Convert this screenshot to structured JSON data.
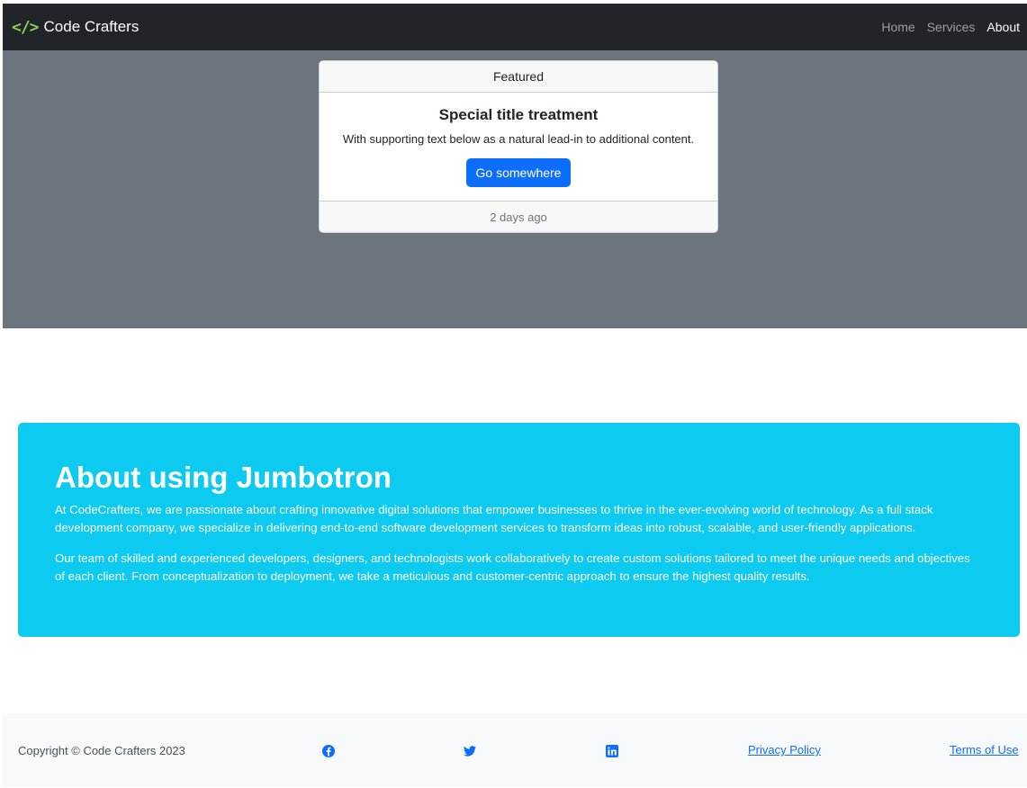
{
  "navbar": {
    "brand_icon": "</>",
    "brand": "Code Crafters",
    "links": [
      {
        "label": "Home",
        "active": false
      },
      {
        "label": "Services",
        "active": false
      },
      {
        "label": "About",
        "active": true
      }
    ]
  },
  "card": {
    "header": "Featured",
    "title": "Special title treatment",
    "text": "With supporting text below as a natural lead-in to additional content.",
    "button": "Go somewhere",
    "footer": "2 days ago"
  },
  "jumbotron": {
    "title": "About using Jumbotron",
    "paragraphs": [
      "At CodeCrafters, we are passionate about crafting innovative digital solutions that empower businesses to thrive in the ever-evolving world of technology. As a full stack development company, we specialize in delivering end-to-end software development services to transform ideas into robust, scalable, and user-friendly applications.",
      "Our team of skilled and experienced developers, designers, and technologists work collaboratively to create custom solutions tailored to meet the unique needs and objectives of each client. From conceptualization to deployment, we take a meticulous and customer-centric approach to ensure the highest quality results."
    ]
  },
  "footer": {
    "copyright": "Copyright © Code Crafters 2023",
    "social": [
      "facebook-icon",
      "twitter-icon",
      "linkedin-icon"
    ],
    "privacy": "Privacy Policy",
    "terms": "Terms of Use"
  },
  "colors": {
    "navbar": "#212529",
    "hero": "#6c757d",
    "primary": "#0d6efd",
    "info": "#0dcaf0",
    "brand_accent": "#8bd14a"
  }
}
